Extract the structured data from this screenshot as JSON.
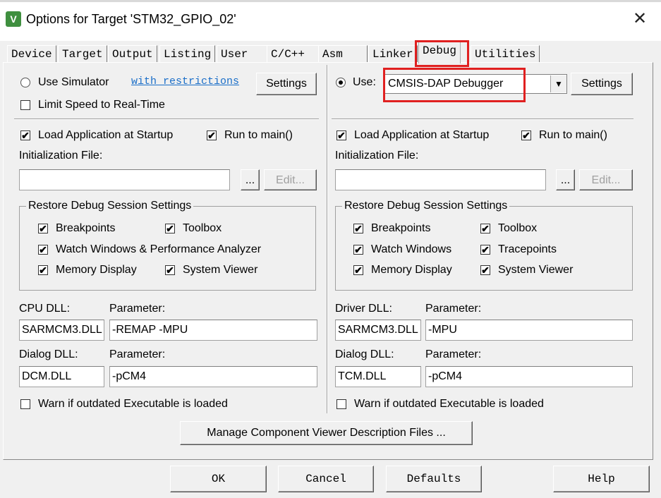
{
  "window": {
    "title": "Options for Target 'STM32_GPIO_02'",
    "close_glyph": "✕",
    "icon_glyph": "V"
  },
  "tabs": [
    {
      "label": "Device"
    },
    {
      "label": "Target"
    },
    {
      "label": "Output"
    },
    {
      "label": "Listing"
    },
    {
      "label": "User"
    },
    {
      "label": "C/C++"
    },
    {
      "label": "Asm"
    },
    {
      "label": "Linker"
    },
    {
      "label": "Debug"
    },
    {
      "label": "Utilities"
    }
  ],
  "left": {
    "use_simulator": "Use Simulator",
    "restrictions_link": "with restrictions",
    "settings": "Settings",
    "limit_speed": "Limit Speed to Real-Time",
    "load_app": "Load Application at Startup",
    "run_to_main": "Run to main()",
    "init_file_label": "Initialization File:",
    "browse": "...",
    "edit": "Edit...",
    "restore_group": "Restore Debug Session Settings",
    "breakpoints": "Breakpoints",
    "toolbox": "Toolbox",
    "watch_windows": "Watch Windows & Performance Analyzer",
    "memory_display": "Memory Display",
    "system_viewer": "System Viewer",
    "dll_label": "CPU DLL:",
    "param_label": "Parameter:",
    "dll_value": "SARMCM3.DLL",
    "param_value": "-REMAP -MPU",
    "dialog_dll_label": "Dialog DLL:",
    "dialog_param_label": "Parameter:",
    "dialog_dll_value": "DCM.DLL",
    "dialog_param_value": "-pCM4",
    "warn": "Warn if outdated Executable is loaded"
  },
  "right": {
    "use_label": "Use:",
    "debugger": "CMSIS-DAP Debugger",
    "settings": "Settings",
    "load_app": "Load Application at Startup",
    "run_to_main": "Run to main()",
    "init_file_label": "Initialization File:",
    "browse": "...",
    "edit": "Edit...",
    "restore_group": "Restore Debug Session Settings",
    "breakpoints": "Breakpoints",
    "toolbox": "Toolbox",
    "watch_windows": "Watch Windows",
    "tracepoints": "Tracepoints",
    "memory_display": "Memory Display",
    "system_viewer": "System Viewer",
    "dll_label": "Driver DLL:",
    "param_label": "Parameter:",
    "dll_value": "SARMCM3.DLL",
    "param_value": "-MPU",
    "dialog_dll_label": "Dialog DLL:",
    "dialog_param_label": "Parameter:",
    "dialog_dll_value": "TCM.DLL",
    "dialog_param_value": "-pCM4",
    "warn": "Warn if outdated Executable is loaded"
  },
  "manage_button": "Manage Component Viewer Description Files ...",
  "footer": {
    "ok": "OK",
    "cancel": "Cancel",
    "defaults": "Defaults",
    "help": "Help"
  },
  "check_glyph": "✔",
  "dropdown_glyph": "▼",
  "colors": {
    "highlight": "#e02020",
    "link": "#1a6ec8"
  }
}
